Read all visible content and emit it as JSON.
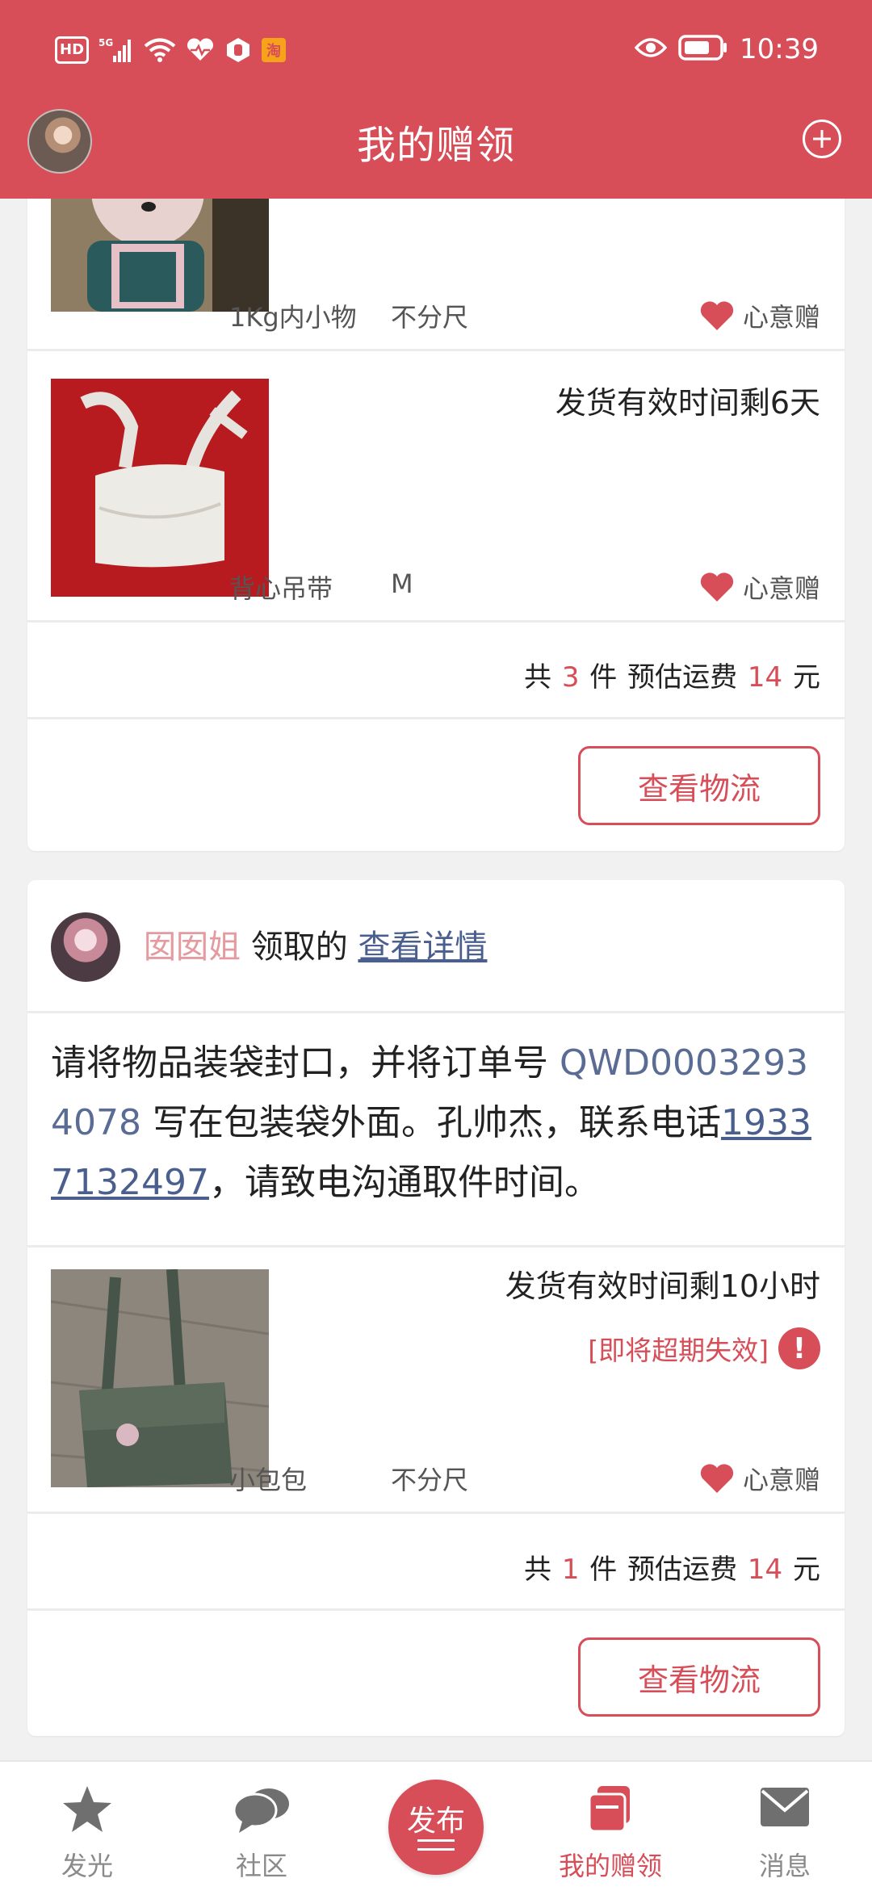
{
  "status_bar": {
    "time": "10:39",
    "hd_label": "HD",
    "network_label": "5G",
    "taobao_label": "淘",
    "icons": [
      "hd-icon",
      "5g-signal-icon",
      "wifi-icon",
      "health-icon",
      "hand-icon",
      "taobao-icon",
      "eye-icon",
      "battery-icon"
    ]
  },
  "header": {
    "title": "我的赠领",
    "plus_icon": "plus-circle-icon"
  },
  "colors": {
    "brand": "#d74d58",
    "link": "#4b5f8e",
    "muted": "#8a8a8a",
    "claimer_name": "#e59a9f"
  },
  "order1": {
    "items": [
      {
        "name": "1Kg内小物",
        "size": "不分尺",
        "tag": "心意赠"
      },
      {
        "name": "背心吊带",
        "size": "M",
        "tag": "心意赠",
        "remaining": "发货有效时间剩6天"
      }
    ],
    "summary": {
      "prefix": "共",
      "count": "3",
      "count_unit": "件",
      "fee_label": "预估运费",
      "fee": "14",
      "fee_unit": "元"
    },
    "button_label": "查看物流"
  },
  "order2": {
    "claimer": "囡囡姐",
    "claim_text": "领取的",
    "details_link": "查看详情",
    "instruction": {
      "part1": "请将物品装袋封口，并将订单号",
      "order_no": "QWD00032934078",
      "part2": "写在包装袋外面。孔帅杰，联系电话",
      "phone": "19337132497",
      "part3": "，请致电沟通取件时间。"
    },
    "items": [
      {
        "name": "小包包",
        "size": "不分尺",
        "tag": "心意赠",
        "remaining": "发货有效时间剩10小时",
        "warning": "[即将超期失效]"
      }
    ],
    "summary": {
      "prefix": "共",
      "count": "1",
      "count_unit": "件",
      "fee_label": "预估运费",
      "fee": "14",
      "fee_unit": "元"
    },
    "button_label": "查看物流"
  },
  "bottom_nav": {
    "items": [
      {
        "label": "发光",
        "icon": "star-icon"
      },
      {
        "label": "社区",
        "icon": "chat-bubbles-icon"
      },
      {
        "label": "发布",
        "icon": "publish-icon"
      },
      {
        "label": "我的赠领",
        "icon": "gift-cards-icon",
        "active": true
      },
      {
        "label": "消息",
        "icon": "mail-icon"
      }
    ]
  }
}
